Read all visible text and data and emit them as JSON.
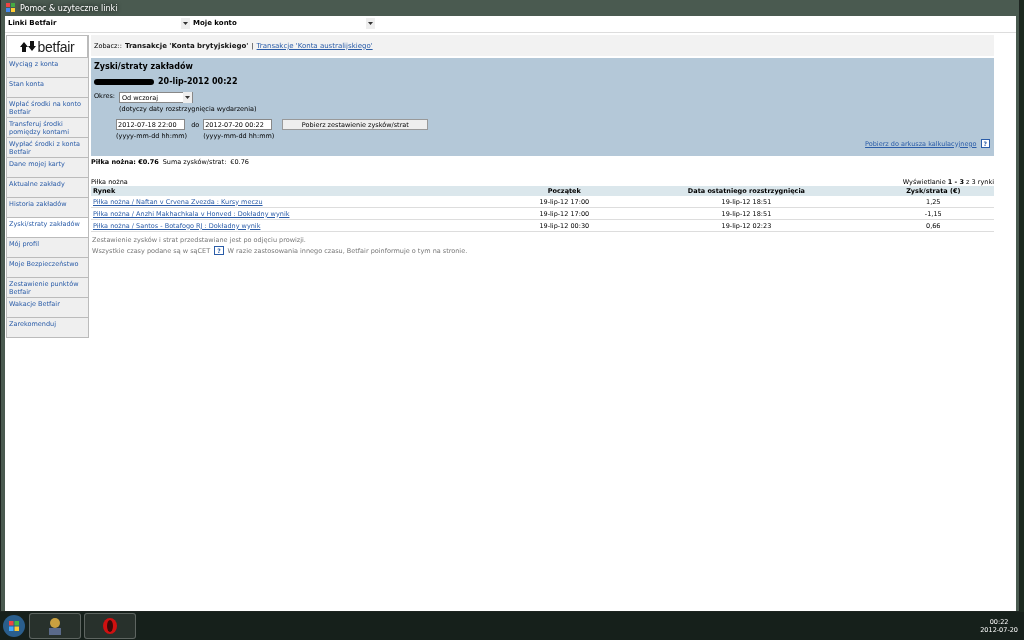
{
  "window": {
    "title": "Pomoc & uzyteczne linki"
  },
  "top_dropdowns": [
    {
      "label": "Linki Betfair"
    },
    {
      "label": "Moje konto"
    }
  ],
  "logo": {
    "text": "betfair"
  },
  "see": {
    "label": "Zobacz::",
    "separator": "|",
    "links": [
      {
        "label": "Transakcje 'Konta brytyjskiego'",
        "selected": true
      },
      {
        "label": "Transakcje 'Konta australijskiego'",
        "selected": false
      }
    ]
  },
  "sidebar": {
    "items": [
      {
        "label": "Wyciąg z konta",
        "selected": false
      },
      {
        "label": "Stan konta",
        "selected": false
      },
      {
        "label": "Wpłać środki na konto Betfair",
        "selected": false
      },
      {
        "label": "Transferuj środki pomiędzy kontami",
        "selected": false
      },
      {
        "label": "Wypłać środki z konta Betfair",
        "selected": false
      },
      {
        "label": "Dane mojej karty",
        "selected": false
      },
      {
        "label": "Aktualne zakłady",
        "selected": false
      },
      {
        "label": "Historia zakładów",
        "selected": false
      },
      {
        "label": "Zyski/straty zakładów",
        "selected": true
      },
      {
        "label": "Mój profil",
        "selected": false
      },
      {
        "label": "Moje Bezpieczeństwo",
        "selected": false
      },
      {
        "label": "Zestawienie punktów Betfair",
        "selected": false
      },
      {
        "label": "Wakacje Betfair",
        "selected": false
      },
      {
        "label": "Zarekomenduj",
        "selected": false
      }
    ]
  },
  "panel": {
    "title": "Zyski/straty zakładów",
    "date": "20-lip-2012 00:22",
    "period_label": "Okres:",
    "period_value": "Od wczoraj",
    "period_hint": "(dotyczy daty rozstrzygnięcia wydarzenia)",
    "from_value": "2012-07-18 22:00",
    "to_label": "do",
    "to_value": "2012-07-20 00:22",
    "from_format": "(yyyy-mm-dd hh:mm)",
    "to_format": "(yyyy-mm-dd hh:mm)",
    "button": "Pobierz zestawienie zysków/strat",
    "spreadsheet_link": "Pobierz do arkusza kalkulacyjnego",
    "help": "?"
  },
  "summary": {
    "sport_total": "Piłka nożna: €0.76",
    "sum_label": "Suma zysków/strat:",
    "sum_value": "€0.76"
  },
  "table": {
    "caption": "Piłka nożna",
    "paging": "Wyświetlanie **1 - 3** z 3 rynki",
    "columns": [
      "Rynek",
      "Początek",
      "Data ostatniego rozstrzygnięcia",
      "Zysk/strata (€)"
    ],
    "rows": [
      [
        "Piłka nożna / Naftan v Crvena Zvezda : Kursy meczu",
        "19-lip-12 17:00",
        "19-lip-12 18:51",
        "1,25"
      ],
      [
        "Piłka nożna / Anzhi Makhachkala v Honved : Dokładny wynik",
        "19-lip-12 17:00",
        "19-lip-12 18:51",
        "-1,15"
      ],
      [
        "Piłka nożna / Santos - Botafogo RJ : Dokładny wynik",
        "19-lip-12 00:30",
        "19-lip-12 02:23",
        "0,66"
      ]
    ]
  },
  "notes": {
    "line1": "Zestawienie zysków i strat przedstawiane jest po odjęciu prowizji.",
    "line2_start": "Wszystkie czasy podane są w sąCET",
    "help": "?",
    "line2_end": "W razie zastosowania innego czasu, Betfair poinformuje o tym na stronie."
  },
  "taskbar": {
    "time": "00:22",
    "date": "2012-07-20"
  }
}
